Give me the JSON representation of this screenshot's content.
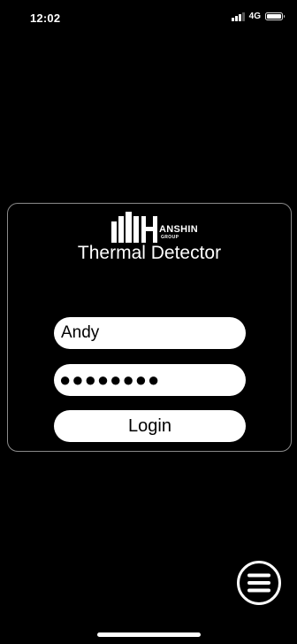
{
  "status_bar": {
    "time": "12:02",
    "network": "4G",
    "signal_icon": "cellular-signal-icon",
    "battery_icon": "battery-icon"
  },
  "brand": {
    "logo_icon": "hanshin-logo-icon",
    "name": "ANSHIN",
    "sub": "GROUP"
  },
  "app": {
    "title": "Thermal Detector"
  },
  "login": {
    "username_value": "Andy",
    "password_display": "●●●●●●●●",
    "button_label": "Login"
  },
  "menu": {
    "icon": "hamburger-menu-icon"
  },
  "colors": {
    "background": "#000000",
    "field_background": "#ffffff",
    "card_border": "#8a8a8a"
  }
}
